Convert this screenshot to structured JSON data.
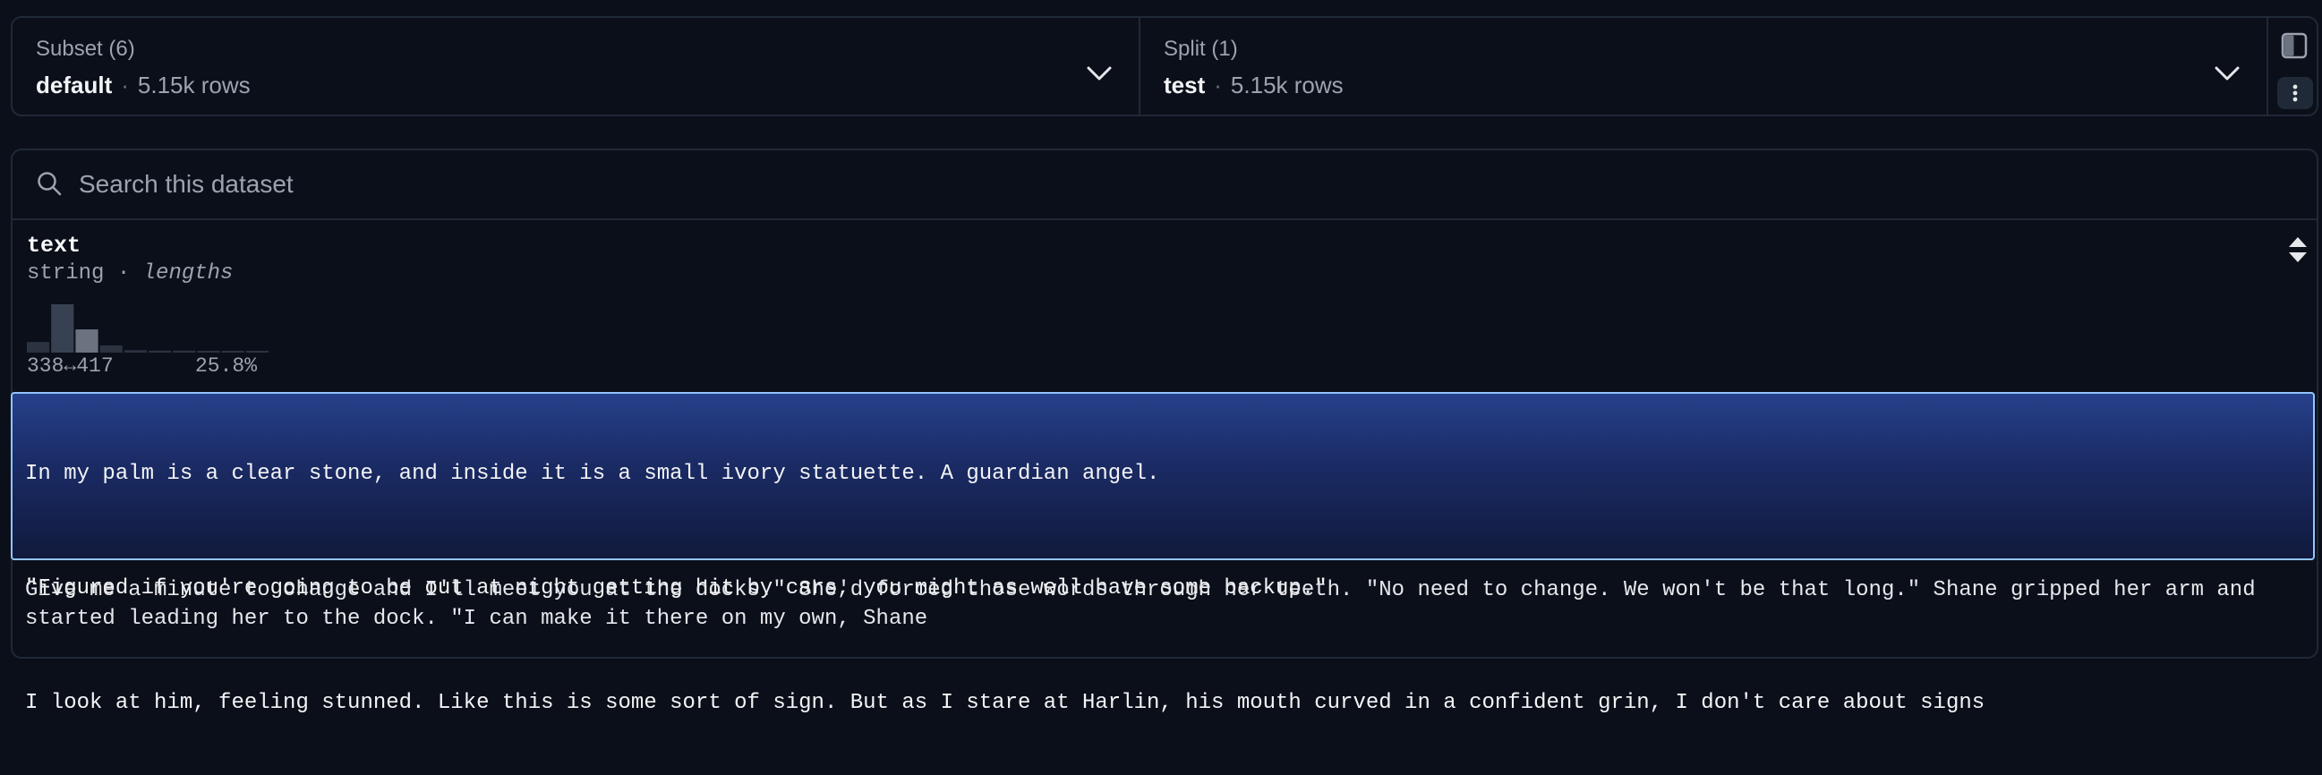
{
  "subset": {
    "title": "Subset (6)",
    "value": "default",
    "separator": "·",
    "rows": "5.15k rows"
  },
  "split": {
    "title": "Split (1)",
    "value": "test",
    "separator": "·",
    "rows": "5.15k rows"
  },
  "search": {
    "placeholder": "Search this dataset"
  },
  "column": {
    "name": "text",
    "type": "string",
    "separator": "·",
    "subtype": "lengths",
    "histogram": {
      "values": [
        0.22,
        1.0,
        0.48,
        0.15,
        0.05,
        0.04,
        0.04,
        0.03,
        0.03,
        0.02
      ],
      "range_label": "338↔417",
      "percent_label": "25.8%",
      "highlighted_bin": 1
    }
  },
  "rows": [
    {
      "lines": [
        "In my palm is a clear stone, and inside it is a small ivory statuette. A guardian angel.",
        "\"Figured if you're going to be out at night getting hit by cars, you might as well have some backup.\"",
        "I look at him, feeling stunned. Like this is some sort of sign. But as I stare at Harlin, his mouth curved in a confident grin, I don't care about signs"
      ]
    },
    {
      "text": "Give me a minute to change and I'll meet you at the docks.\" She'd forced those words through her teeth. \"No need to change. We won't be that long.\" Shane gripped her arm and started leading her to the dock. \"I can make it there on my own, Shane"
    }
  ],
  "colors": {
    "background": "#0b0f19",
    "border": "#1f2937",
    "selected_row": "#1e3a8a",
    "selected_border": "#93c5fd"
  },
  "icons": [
    "chevron-down-icon",
    "panel-toggle-icon",
    "more-vertical-icon",
    "search-icon",
    "sort-icon"
  ]
}
